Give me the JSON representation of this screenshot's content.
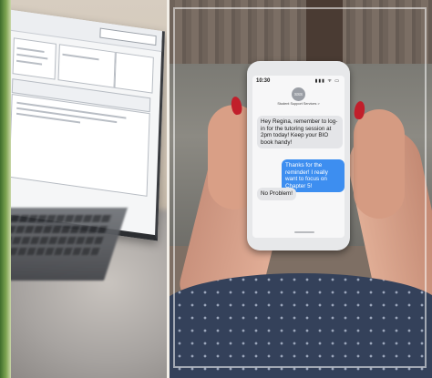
{
  "phone": {
    "status_time": "10:30",
    "status_icons": "▮▮▮ ᯤ ▭",
    "contact_avatar": "SSS",
    "contact_name": "Student Support Services",
    "messages": [
      {
        "direction": "incoming",
        "text": "Hey Regina, remember to log-in for the tutoring session at 2pm today! Keep your BIO book handy!"
      },
      {
        "direction": "outgoing",
        "text": "Thanks for the reminder! I really want to focus on Chapter 5!"
      },
      {
        "direction": "incoming",
        "text": "No Problem!"
      }
    ]
  },
  "colors": {
    "outgoing_bubble": "#3d8ef0",
    "incoming_bubble": "#e4e5e8",
    "nail_polish": "#c11f2b",
    "divider": "#f3efe8"
  },
  "icons": {
    "signal": "signal-icon",
    "wifi": "wifi-icon",
    "battery": "battery-icon"
  }
}
